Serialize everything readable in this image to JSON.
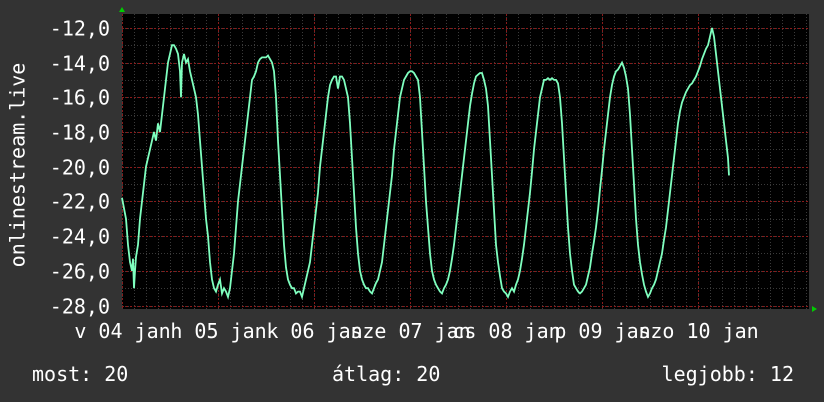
{
  "chart_data": {
    "type": "line",
    "ylabel": "onlinestream.live",
    "xlabel": "",
    "title": "",
    "ylim": [
      -28.2,
      -11.2
    ],
    "yticks": [
      -12,
      -14,
      -16,
      -18,
      -20,
      -22,
      -24,
      -26,
      -28
    ],
    "ytick_labels": [
      "-12,0",
      "-14,0",
      "-16,0",
      "-18,0",
      "-20,0",
      "-22,0",
      "-24,0",
      "-26,0",
      "-28,0"
    ],
    "x_range": [
      0,
      687
    ],
    "xticks": [
      {
        "x": 0,
        "label": "v 04 jan"
      },
      {
        "x": 96,
        "label": "h 05 jan"
      },
      {
        "x": 192,
        "label": "k 06 jan"
      },
      {
        "x": 288,
        "label": "sze 07 jan"
      },
      {
        "x": 384,
        "label": "cs 08 jan"
      },
      {
        "x": 480,
        "label": "p 09 jan"
      },
      {
        "x": 576,
        "label": "szo 10 jan"
      }
    ],
    "grid": true,
    "colors": {
      "background": "#333333",
      "plot_background": "#000000",
      "line": "#7fffbf",
      "grid_major": "#8a1a1a",
      "grid_minor": "#3a3a3a",
      "axis_arrow": "#00cc00"
    },
    "series": [
      {
        "values": [
          [
            0,
            -21.8
          ],
          [
            4,
            -23.0
          ],
          [
            6,
            -24.5
          ],
          [
            8,
            -25.5
          ],
          [
            10,
            -26.0
          ],
          [
            11,
            -25.3
          ],
          [
            12,
            -27.0
          ],
          [
            13,
            -26.0
          ],
          [
            14,
            -25.2
          ],
          [
            16,
            -24.5
          ],
          [
            18,
            -23.0
          ],
          [
            20,
            -22.0
          ],
          [
            22,
            -21.0
          ],
          [
            24,
            -20.0
          ],
          [
            26,
            -19.5
          ],
          [
            28,
            -19.0
          ],
          [
            30,
            -18.5
          ],
          [
            32,
            -18.0
          ],
          [
            34,
            -18.5
          ],
          [
            36,
            -17.5
          ],
          [
            38,
            -18.0
          ],
          [
            40,
            -17.0
          ],
          [
            42,
            -16.0
          ],
          [
            44,
            -15.0
          ],
          [
            46,
            -14.0
          ],
          [
            48,
            -13.5
          ],
          [
            50,
            -13.0
          ],
          [
            52,
            -13.0
          ],
          [
            54,
            -13.2
          ],
          [
            56,
            -13.5
          ],
          [
            58,
            -14.5
          ],
          [
            59,
            -16.0
          ],
          [
            60,
            -14.0
          ],
          [
            62,
            -13.5
          ],
          [
            64,
            -14.0
          ],
          [
            66,
            -13.8
          ],
          [
            68,
            -14.5
          ],
          [
            70,
            -15.0
          ],
          [
            72,
            -15.5
          ],
          [
            74,
            -16.0
          ],
          [
            76,
            -17.0
          ],
          [
            78,
            -18.5
          ],
          [
            80,
            -20.0
          ],
          [
            82,
            -21.5
          ],
          [
            84,
            -23.0
          ],
          [
            86,
            -24.0
          ],
          [
            88,
            -25.5
          ],
          [
            90,
            -26.5
          ],
          [
            92,
            -27.0
          ],
          [
            94,
            -27.2
          ],
          [
            96,
            -26.8
          ],
          [
            98,
            -26.5
          ],
          [
            100,
            -27.3
          ],
          [
            102,
            -27.0
          ],
          [
            104,
            -27.2
          ],
          [
            106,
            -27.5
          ],
          [
            108,
            -27.0
          ],
          [
            110,
            -26.0
          ],
          [
            112,
            -25.0
          ],
          [
            114,
            -23.5
          ],
          [
            116,
            -22.0
          ],
          [
            118,
            -21.0
          ],
          [
            120,
            -20.0
          ],
          [
            122,
            -19.0
          ],
          [
            124,
            -18.0
          ],
          [
            126,
            -17.0
          ],
          [
            128,
            -16.0
          ],
          [
            130,
            -15.0
          ],
          [
            132,
            -14.8
          ],
          [
            134,
            -14.5
          ],
          [
            136,
            -14.0
          ],
          [
            138,
            -13.8
          ],
          [
            140,
            -13.7
          ],
          [
            142,
            -13.7
          ],
          [
            144,
            -13.7
          ],
          [
            146,
            -13.6
          ],
          [
            148,
            -13.8
          ],
          [
            150,
            -14.0
          ],
          [
            152,
            -14.5
          ],
          [
            154,
            -16.0
          ],
          [
            156,
            -18.5
          ],
          [
            158,
            -20.5
          ],
          [
            160,
            -22.5
          ],
          [
            162,
            -24.5
          ],
          [
            164,
            -25.8
          ],
          [
            166,
            -26.5
          ],
          [
            168,
            -26.8
          ],
          [
            170,
            -27.0
          ],
          [
            172,
            -27.0
          ],
          [
            174,
            -27.3
          ],
          [
            176,
            -27.2
          ],
          [
            178,
            -27.2
          ],
          [
            180,
            -27.5
          ],
          [
            182,
            -27.0
          ],
          [
            184,
            -26.5
          ],
          [
            186,
            -26.0
          ],
          [
            188,
            -25.5
          ],
          [
            190,
            -24.5
          ],
          [
            192,
            -23.5
          ],
          [
            194,
            -22.5
          ],
          [
            196,
            -21.5
          ],
          [
            198,
            -20.0
          ],
          [
            200,
            -19.0
          ],
          [
            202,
            -18.0
          ],
          [
            204,
            -17.0
          ],
          [
            206,
            -16.0
          ],
          [
            208,
            -15.3
          ],
          [
            210,
            -15.0
          ],
          [
            212,
            -14.8
          ],
          [
            214,
            -14.8
          ],
          [
            216,
            -15.5
          ],
          [
            218,
            -14.8
          ],
          [
            220,
            -14.8
          ],
          [
            222,
            -15.0
          ],
          [
            224,
            -15.5
          ],
          [
            226,
            -16.0
          ],
          [
            228,
            -17.5
          ],
          [
            230,
            -19.5
          ],
          [
            232,
            -21.5
          ],
          [
            234,
            -23.5
          ],
          [
            236,
            -25.0
          ],
          [
            238,
            -26.0
          ],
          [
            240,
            -26.5
          ],
          [
            242,
            -26.8
          ],
          [
            244,
            -27.0
          ],
          [
            246,
            -27.0
          ],
          [
            248,
            -27.2
          ],
          [
            250,
            -27.3
          ],
          [
            252,
            -27.0
          ],
          [
            254,
            -26.7
          ],
          [
            256,
            -26.5
          ],
          [
            258,
            -26.0
          ],
          [
            260,
            -25.5
          ],
          [
            262,
            -24.5
          ],
          [
            264,
            -23.5
          ],
          [
            266,
            -22.5
          ],
          [
            268,
            -21.5
          ],
          [
            270,
            -20.5
          ],
          [
            272,
            -19.0
          ],
          [
            274,
            -18.0
          ],
          [
            276,
            -17.0
          ],
          [
            278,
            -16.0
          ],
          [
            280,
            -15.5
          ],
          [
            282,
            -15.0
          ],
          [
            284,
            -14.8
          ],
          [
            286,
            -14.6
          ],
          [
            288,
            -14.5
          ],
          [
            290,
            -14.5
          ],
          [
            292,
            -14.6
          ],
          [
            294,
            -14.8
          ],
          [
            296,
            -15.0
          ],
          [
            298,
            -16.0
          ],
          [
            300,
            -18.0
          ],
          [
            302,
            -20.0
          ],
          [
            304,
            -22.0
          ],
          [
            306,
            -23.5
          ],
          [
            308,
            -25.0
          ],
          [
            310,
            -26.0
          ],
          [
            312,
            -26.5
          ],
          [
            314,
            -26.8
          ],
          [
            316,
            -27.0
          ],
          [
            318,
            -27.2
          ],
          [
            320,
            -27.3
          ],
          [
            322,
            -27.0
          ],
          [
            324,
            -26.8
          ],
          [
            326,
            -26.5
          ],
          [
            328,
            -26.0
          ],
          [
            330,
            -25.3
          ],
          [
            332,
            -24.5
          ],
          [
            334,
            -23.5
          ],
          [
            336,
            -22.5
          ],
          [
            338,
            -21.5
          ],
          [
            340,
            -20.5
          ],
          [
            342,
            -19.5
          ],
          [
            344,
            -18.5
          ],
          [
            346,
            -17.5
          ],
          [
            348,
            -16.5
          ],
          [
            350,
            -15.8
          ],
          [
            352,
            -15.2
          ],
          [
            354,
            -14.8
          ],
          [
            356,
            -14.7
          ],
          [
            358,
            -14.6
          ],
          [
            360,
            -14.6
          ],
          [
            362,
            -15.0
          ],
          [
            364,
            -15.5
          ],
          [
            366,
            -16.5
          ],
          [
            368,
            -18.5
          ],
          [
            370,
            -20.5
          ],
          [
            372,
            -22.5
          ],
          [
            374,
            -24.5
          ],
          [
            376,
            -25.5
          ],
          [
            378,
            -26.3
          ],
          [
            380,
            -27.0
          ],
          [
            382,
            -27.2
          ],
          [
            384,
            -27.3
          ],
          [
            386,
            -27.5
          ],
          [
            388,
            -27.2
          ],
          [
            390,
            -27.0
          ],
          [
            392,
            -27.2
          ],
          [
            394,
            -26.8
          ],
          [
            396,
            -26.5
          ],
          [
            398,
            -26.0
          ],
          [
            400,
            -25.3
          ],
          [
            402,
            -24.5
          ],
          [
            404,
            -23.5
          ],
          [
            406,
            -22.5
          ],
          [
            408,
            -21.5
          ],
          [
            410,
            -20.3
          ],
          [
            412,
            -19.0
          ],
          [
            414,
            -18.0
          ],
          [
            416,
            -17.0
          ],
          [
            418,
            -16.0
          ],
          [
            420,
            -15.5
          ],
          [
            422,
            -15.0
          ],
          [
            424,
            -15.0
          ],
          [
            426,
            -14.9
          ],
          [
            428,
            -15.0
          ],
          [
            430,
            -14.9
          ],
          [
            432,
            -15.0
          ],
          [
            434,
            -15.0
          ],
          [
            436,
            -15.2
          ],
          [
            438,
            -16.0
          ],
          [
            440,
            -17.5
          ],
          [
            442,
            -19.5
          ],
          [
            444,
            -21.5
          ],
          [
            446,
            -23.5
          ],
          [
            448,
            -25.0
          ],
          [
            450,
            -26.0
          ],
          [
            452,
            -26.8
          ],
          [
            454,
            -27.0
          ],
          [
            456,
            -27.2
          ],
          [
            458,
            -27.3
          ],
          [
            460,
            -27.2
          ],
          [
            462,
            -27.0
          ],
          [
            464,
            -26.8
          ],
          [
            466,
            -26.3
          ],
          [
            468,
            -25.8
          ],
          [
            470,
            -25.0
          ],
          [
            472,
            -24.3
          ],
          [
            474,
            -23.5
          ],
          [
            476,
            -22.5
          ],
          [
            478,
            -21.3
          ],
          [
            480,
            -20.2
          ],
          [
            482,
            -19.0
          ],
          [
            484,
            -18.0
          ],
          [
            486,
            -17.0
          ],
          [
            488,
            -16.0
          ],
          [
            490,
            -15.3
          ],
          [
            492,
            -14.8
          ],
          [
            494,
            -14.5
          ],
          [
            496,
            -14.4
          ],
          [
            498,
            -14.2
          ],
          [
            500,
            -14.0
          ],
          [
            502,
            -14.3
          ],
          [
            504,
            -14.8
          ],
          [
            506,
            -15.5
          ],
          [
            508,
            -17.0
          ],
          [
            510,
            -19.0
          ],
          [
            512,
            -21.0
          ],
          [
            514,
            -23.0
          ],
          [
            516,
            -24.5
          ],
          [
            518,
            -25.5
          ],
          [
            520,
            -26.2
          ],
          [
            522,
            -26.8
          ],
          [
            524,
            -27.2
          ],
          [
            526,
            -27.5
          ],
          [
            528,
            -27.3
          ],
          [
            530,
            -27.0
          ],
          [
            532,
            -26.8
          ],
          [
            534,
            -26.5
          ],
          [
            536,
            -26.0
          ],
          [
            538,
            -25.5
          ],
          [
            540,
            -25.0
          ],
          [
            542,
            -24.2
          ],
          [
            544,
            -23.5
          ],
          [
            546,
            -22.5
          ],
          [
            548,
            -21.5
          ],
          [
            550,
            -20.5
          ],
          [
            552,
            -19.5
          ],
          [
            554,
            -18.5
          ],
          [
            556,
            -17.5
          ],
          [
            558,
            -16.8
          ],
          [
            560,
            -16.3
          ],
          [
            562,
            -16.0
          ],
          [
            564,
            -15.7
          ],
          [
            566,
            -15.5
          ],
          [
            568,
            -15.3
          ],
          [
            570,
            -15.2
          ],
          [
            572,
            -15.0
          ],
          [
            574,
            -14.8
          ],
          [
            576,
            -14.5
          ],
          [
            578,
            -14.2
          ],
          [
            580,
            -13.8
          ],
          [
            582,
            -13.5
          ],
          [
            584,
            -13.2
          ],
          [
            586,
            -13.0
          ],
          [
            588,
            -12.5
          ],
          [
            590,
            -12.0
          ],
          [
            592,
            -12.5
          ],
          [
            594,
            -13.5
          ],
          [
            596,
            -14.5
          ],
          [
            598,
            -15.5
          ],
          [
            600,
            -16.5
          ],
          [
            602,
            -17.5
          ],
          [
            604,
            -18.5
          ],
          [
            606,
            -19.5
          ],
          [
            607,
            -20.5
          ]
        ]
      }
    ]
  },
  "stats": {
    "now": "most: 20",
    "avg": "átlag: 20",
    "max": "legjobb: 12"
  }
}
